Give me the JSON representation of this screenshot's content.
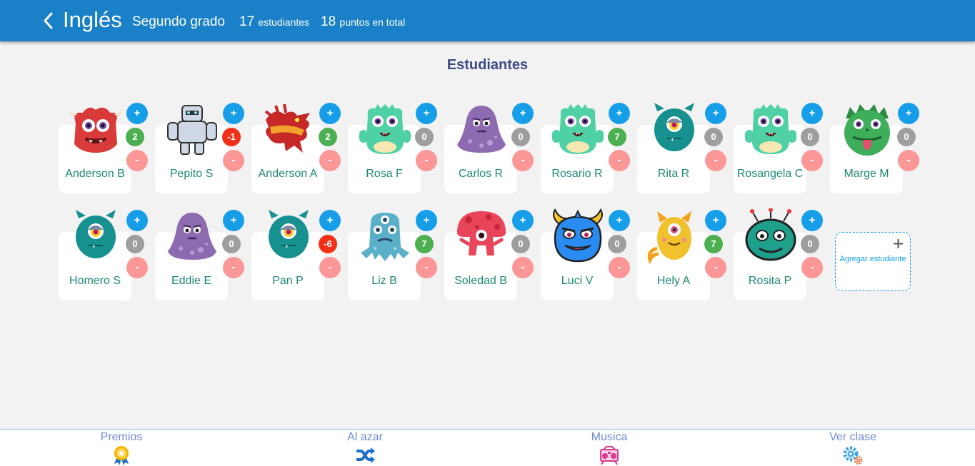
{
  "header": {
    "title": "Inglés",
    "grade": "Segundo grado",
    "students_count": "17",
    "students_label": "estudiantes",
    "points_count": "18",
    "points_label": "puntos en total",
    "color": "#1a80c8"
  },
  "section_title": "Estudiantes",
  "buttons": {
    "plus": "+",
    "minus": "-"
  },
  "students": [
    {
      "name": "Anderson B",
      "points": "2",
      "monster": "red-furry-monster-icon",
      "color": "#d93a3a",
      "badge": "#4caf50"
    },
    {
      "name": "Pepito S",
      "points": "-1",
      "monster": "robot-golem-icon",
      "color": "#cfd8e6",
      "badge": "#f22f17"
    },
    {
      "name": "Anderson A",
      "points": "2",
      "monster": "red-dragon-icon",
      "color": "#c62828",
      "badge": "#4caf50"
    },
    {
      "name": "Rosa F",
      "points": "0",
      "monster": "green-monster-icon",
      "color": "#4fd1a5",
      "badge": "#9e9e9e"
    },
    {
      "name": "Carlos R",
      "points": "0",
      "monster": "purple-blob-icon",
      "color": "#8e6bb0",
      "badge": "#9e9e9e"
    },
    {
      "name": "Rosario R",
      "points": "7",
      "monster": "green-monster-icon",
      "color": "#4fd1a5",
      "badge": "#4caf50"
    },
    {
      "name": "Rita R",
      "points": "0",
      "monster": "teal-cyclops-icon",
      "color": "#16918f",
      "badge": "#9e9e9e"
    },
    {
      "name": "Rosangela C",
      "points": "0",
      "monster": "green-monster-icon",
      "color": "#4fd1a5",
      "badge": "#9e9e9e"
    },
    {
      "name": "Marge M",
      "points": "0",
      "monster": "green-tongue-monster-icon",
      "color": "#3fae5a",
      "badge": "#9e9e9e"
    },
    {
      "name": "Homero S",
      "points": "0",
      "monster": "teal-cyclops-icon",
      "color": "#16918f",
      "badge": "#9e9e9e"
    },
    {
      "name": "Eddie E",
      "points": "0",
      "monster": "purple-blob-icon",
      "color": "#8e6bb0",
      "badge": "#9e9e9e"
    },
    {
      "name": "Pan P",
      "points": "-6",
      "monster": "teal-cyclops-icon",
      "color": "#16918f",
      "badge": "#f22f17"
    },
    {
      "name": "Liz B",
      "points": "7",
      "monster": "blue-three-eyed-monster-icon",
      "color": "#5ab0c9",
      "badge": "#4caf50"
    },
    {
      "name": "Soledad B",
      "points": "0",
      "monster": "red-mushroom-monster-icon",
      "color": "#e8445a",
      "badge": "#9e9e9e"
    },
    {
      "name": "Luci V",
      "points": "0",
      "monster": "blue-horned-monster-icon",
      "color": "#2a8cf0",
      "badge": "#9e9e9e"
    },
    {
      "name": "Hely A",
      "points": "7",
      "monster": "yellow-cat-monster-icon",
      "color": "#f2c12e",
      "badge": "#4caf50"
    },
    {
      "name": "Rosita P",
      "points": "0",
      "monster": "teal-antenna-monster-icon",
      "color": "#1fa08a",
      "badge": "#9e9e9e"
    }
  ],
  "add_student": {
    "label": "Agregar estudiante"
  },
  "bottom_nav": [
    {
      "label": "Premios",
      "icon": "award-ribbon-icon"
    },
    {
      "label": "Al azar",
      "icon": "shuffle-icon"
    },
    {
      "label": "Musica",
      "icon": "boombox-icon"
    },
    {
      "label": "Ver clase",
      "icon": "gears-icon"
    }
  ]
}
